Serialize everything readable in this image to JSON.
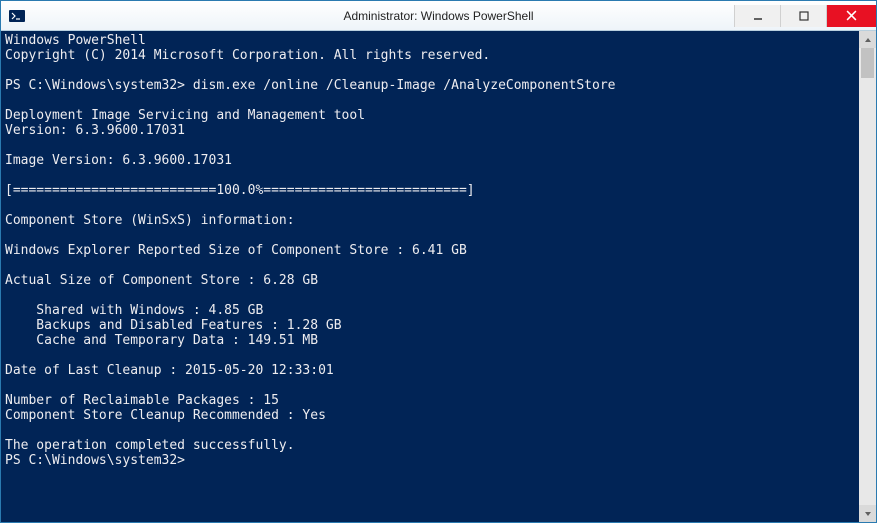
{
  "window": {
    "title": "Administrator: Windows PowerShell"
  },
  "console": {
    "header1": "Windows PowerShell",
    "header2": "Copyright (C) 2014 Microsoft Corporation. All rights reserved.",
    "blank": "",
    "prompt1": "PS C:\\Windows\\system32> dism.exe /online /Cleanup-Image /AnalyzeComponentStore",
    "tool1": "Deployment Image Servicing and Management tool",
    "tool2": "Version: 6.3.9600.17031",
    "imgver": "Image Version: 6.3.9600.17031",
    "progress": "[==========================100.0%==========================]",
    "csinfo": "Component Store (WinSxS) information:",
    "reported": "Windows Explorer Reported Size of Component Store : 6.41 GB",
    "actual": "Actual Size of Component Store : 6.28 GB",
    "shared": "    Shared with Windows : 4.85 GB",
    "backups": "    Backups and Disabled Features : 1.28 GB",
    "cache": "    Cache and Temporary Data : 149.51 MB",
    "lastcleanup": "Date of Last Cleanup : 2015-05-20 12:33:01",
    "reclaim": "Number of Reclaimable Packages : 15",
    "recommended": "Component Store Cleanup Recommended : Yes",
    "success": "The operation completed successfully.",
    "prompt2": "PS C:\\Windows\\system32>"
  }
}
